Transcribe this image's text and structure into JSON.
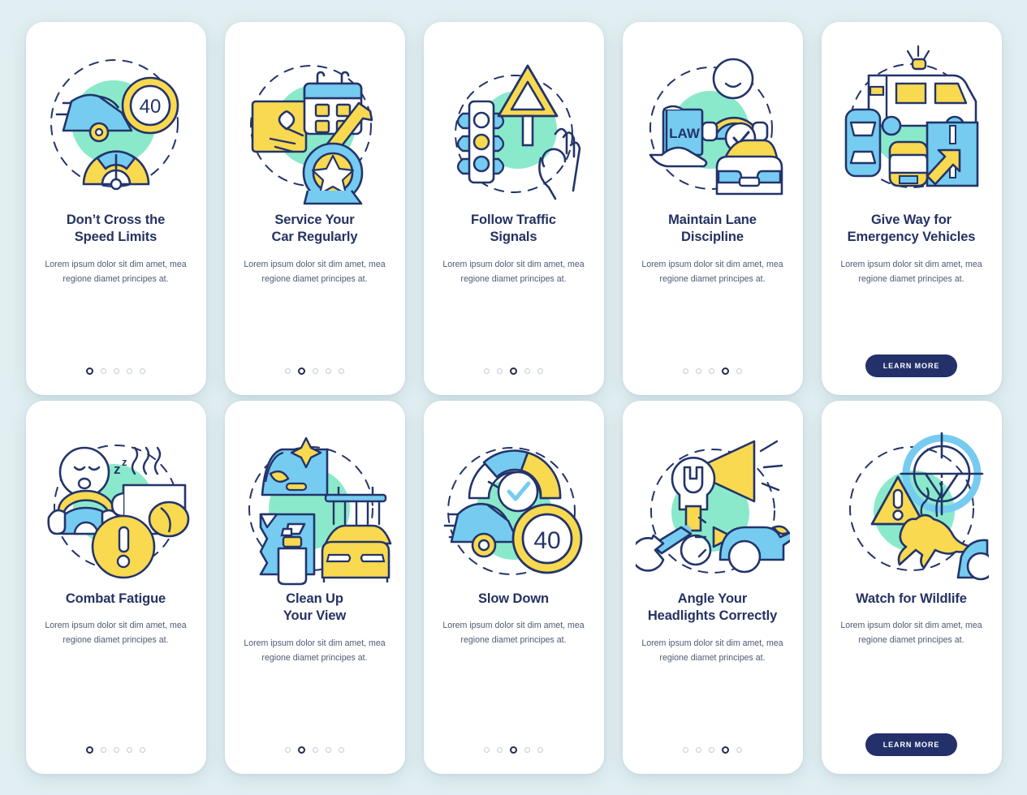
{
  "page": {
    "background_color": "#e2eff2",
    "title_color": "#253262",
    "body_text_color": "#4e5b72",
    "button_color": "#23306a",
    "accent_yellow": "#f7d74e",
    "accent_blue": "#6fc9ef",
    "accent_mint": "#86e8c8",
    "rows": 2,
    "columns": 5
  },
  "shared": {
    "description": "Lorem ipsum dolor sit dim amet, mea regione diamet principes at.",
    "learn_more_label": "LEARN MORE",
    "dot_count": 5
  },
  "screens": [
    {
      "id": "dont-cross-the-speed-limits",
      "title": "Don’t Cross the\nSpeed Limits",
      "title_line1": "Don’t Cross the",
      "title_line2": "Speed Limits",
      "description": "Lorem ipsum dolor sit dim amet, mea regione diamet principes at.",
      "illustration": "speed-limit-car-icon",
      "illustration_label": "40",
      "footer": "dots",
      "active_dot": 1
    },
    {
      "id": "service-your-car-regularly",
      "title": "Service Your\nCar Regularly",
      "title_line1": "Service Your",
      "title_line2": "Car Regularly",
      "description": "Lorem ipsum dolor sit dim amet, mea regione diamet principes at.",
      "illustration": "calendar-wrench-tire-icon",
      "footer": "dots",
      "active_dot": 2
    },
    {
      "id": "follow-traffic-signals",
      "title": "Follow Traffic\nSignals",
      "title_line1": "Follow Traffic",
      "title_line2": "Signals",
      "description": "Lorem ipsum dolor sit dim amet, mea regione diamet principes at.",
      "illustration": "traffic-light-warning-sign-icon",
      "footer": "dots",
      "active_dot": 3
    },
    {
      "id": "maintain-lane-discipline",
      "title": "Maintain Lane\nDiscipline",
      "title_line1": "Maintain Lane",
      "title_line2": "Discipline",
      "description": "Lorem ipsum dolor sit dim amet, mea regione diamet principes at.",
      "illustration": "law-book-driver-car-icon",
      "illustration_label": "LAW",
      "footer": "dots",
      "active_dot": 4
    },
    {
      "id": "give-way-for-emergency-vehicles",
      "title": "Give Way for\nEmergency Vehicles",
      "title_line1": "Give Way for",
      "title_line2": "Emergency Vehicles",
      "description": "Lorem ipsum dolor sit dim amet, mea regione diamet principes at.",
      "illustration": "ambulance-road-merge-icon",
      "footer": "button",
      "button_label": "LEARN MORE"
    },
    {
      "id": "combat-fatigue",
      "title": "Combat Fatigue",
      "title_line1": "Combat Fatigue",
      "title_line2": "",
      "description": "Lorem ipsum dolor sit dim amet, mea regione diamet principes at.",
      "illustration": "sleepy-face-coffee-alert-icon",
      "footer": "dots",
      "active_dot": 1
    },
    {
      "id": "clean-up-your-view",
      "title": "Clean Up\nYour View",
      "title_line1": "Clean Up",
      "title_line2": "Your View",
      "description": "Lorem ipsum dolor sit dim amet, mea regione diamet principes at.",
      "illustration": "car-wash-spray-bottle-icon",
      "footer": "dots",
      "active_dot": 2
    },
    {
      "id": "slow-down",
      "title": "Slow Down",
      "title_line1": "Slow Down",
      "title_line2": "",
      "description": "Lorem ipsum dolor sit dim amet, mea regione diamet principes at.",
      "illustration": "speedometer-check-speed-sign-icon",
      "illustration_label": "40",
      "footer": "dots",
      "active_dot": 3
    },
    {
      "id": "angle-your-headlights-correctly",
      "title": "Angle Your\nHeadlights Correctly",
      "title_line1": "Angle Your",
      "title_line2": "Headlights Correctly",
      "description": "Lorem ipsum dolor sit dim amet, mea regione diamet principes at.",
      "illustration": "wrench-headlight-beam-icon",
      "footer": "dots",
      "active_dot": 4
    },
    {
      "id": "watch-for-wildlife",
      "title": "Watch for Wildlife",
      "title_line1": "Watch for Wildlife",
      "title_line2": "",
      "description": "Lorem ipsum dolor sit dim amet, mea regione diamet principes at.",
      "illustration": "deer-warning-crosshair-icon",
      "footer": "button",
      "button_label": "LEARN MORE"
    }
  ]
}
